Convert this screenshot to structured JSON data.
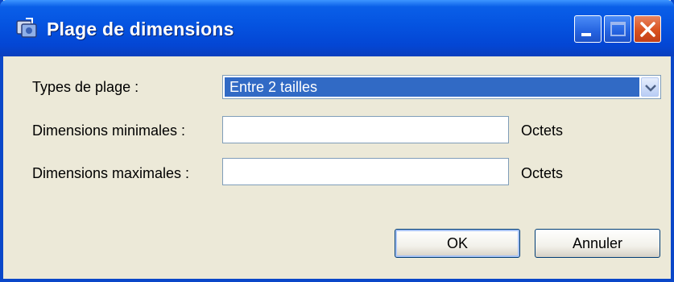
{
  "window": {
    "title": "Plage de dimensions",
    "title_icon": "app-icon",
    "controls": {
      "minimize": "minimize-icon",
      "maximize": "maximize-icon",
      "close": "close-icon"
    }
  },
  "form": {
    "range_type": {
      "label": "Types de plage :",
      "value": "Entre 2 tailles"
    },
    "min_size": {
      "label": "Dimensions minimales :",
      "value": "",
      "unit": "Octets"
    },
    "max_size": {
      "label": "Dimensions maximales :",
      "value": "",
      "unit": "Octets"
    }
  },
  "buttons": {
    "ok": "OK",
    "cancel": "Annuler"
  },
  "colors": {
    "titlebar": "#0553e0",
    "selection": "#316ac5",
    "dialog_bg": "#ece9d8"
  }
}
